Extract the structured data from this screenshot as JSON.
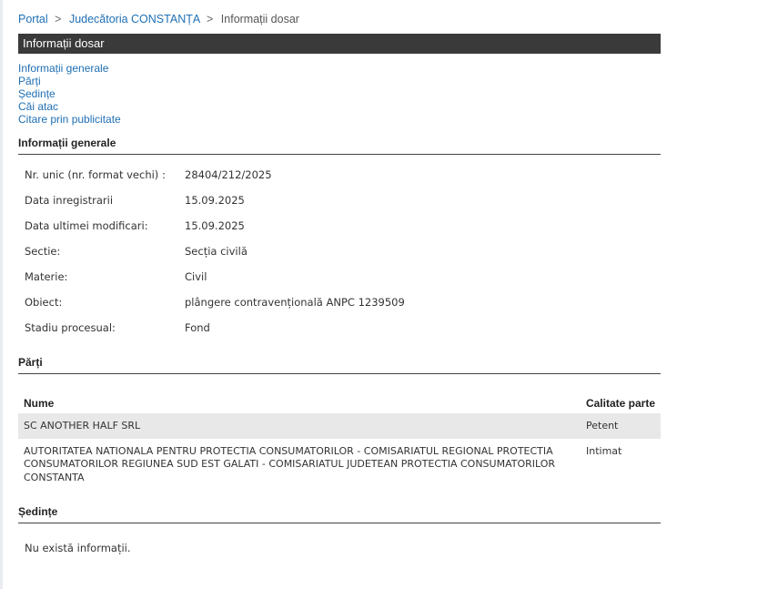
{
  "breadcrumb": {
    "portal": "Portal",
    "court": "Judecătoria CONSTANȚA",
    "current": "Informații dosar",
    "separator": ">"
  },
  "page_title": "Informații dosar",
  "nav": {
    "items": [
      "Informații generale",
      "Părți",
      "Ședințe",
      "Căi atac",
      "Citare prin publicitate"
    ]
  },
  "general": {
    "heading": "Informații generale",
    "rows": [
      {
        "label": "Nr. unic (nr. format vechi) :",
        "value": "28404/212/2025"
      },
      {
        "label": "Data inregistrarii",
        "value": "15.09.2025"
      },
      {
        "label": "Data ultimei modificari:",
        "value": "15.09.2025"
      },
      {
        "label": "Sectie:",
        "value": "Secția civilă"
      },
      {
        "label": "Materie:",
        "value": "Civil"
      },
      {
        "label": "Obiect:",
        "value": "plângere contravențională ANPC 1239509"
      },
      {
        "label": "Stadiu procesual:",
        "value": "Fond"
      }
    ]
  },
  "parti": {
    "heading": "Părți",
    "columns": [
      "Nume",
      "Calitate parte"
    ],
    "rows": [
      {
        "name": "SC ANOTHER HALF SRL",
        "role": "Petent"
      },
      {
        "name": "AUTORITATEA NATIONALA PENTRU PROTECTIA CONSUMATORILOR - COMISARIATUL REGIONAL PROTECTIA CONSUMATORILOR REGIUNEA SUD EST GALATI - COMISARIATUL JUDETEAN PROTECTIA CONSUMATORILOR CONSTANTA",
        "role": "Intimat"
      }
    ]
  },
  "sedinte": {
    "heading": "Ședințe",
    "empty_message": "Nu există informații."
  },
  "colors": {
    "link": "#1f6fb4",
    "title_bar": "#3a3a3a",
    "row_shade": "#e8e8e8"
  }
}
